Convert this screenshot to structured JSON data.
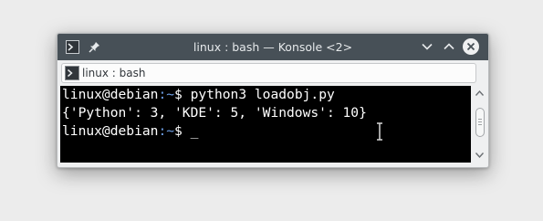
{
  "window": {
    "title": "linux : bash — Konsole <2>",
    "icons": {
      "app": "konsole-icon",
      "pin": "pin-icon",
      "minimize": "chevron-down-icon",
      "maximize": "chevron-up-icon",
      "close": "close-icon"
    }
  },
  "tab": {
    "label": "linux : bash",
    "icon": "terminal-icon"
  },
  "terminal": {
    "lines": [
      {
        "user": "linux@debian",
        "path": ":~",
        "symbol": "$",
        "command": "python3 loadobj.py"
      },
      {
        "output": "{'Python': 3, 'KDE': 5, 'Windows': 10}"
      },
      {
        "user": "linux@debian",
        "path": ":~",
        "symbol": "$",
        "cursor": "_"
      }
    ]
  },
  "colors": {
    "titlebar": "#475057",
    "terminal_bg": "#000000",
    "terminal_fg": "#ffffff",
    "prompt_path": "#6ea0e8",
    "close_button": "#eff0f1"
  }
}
